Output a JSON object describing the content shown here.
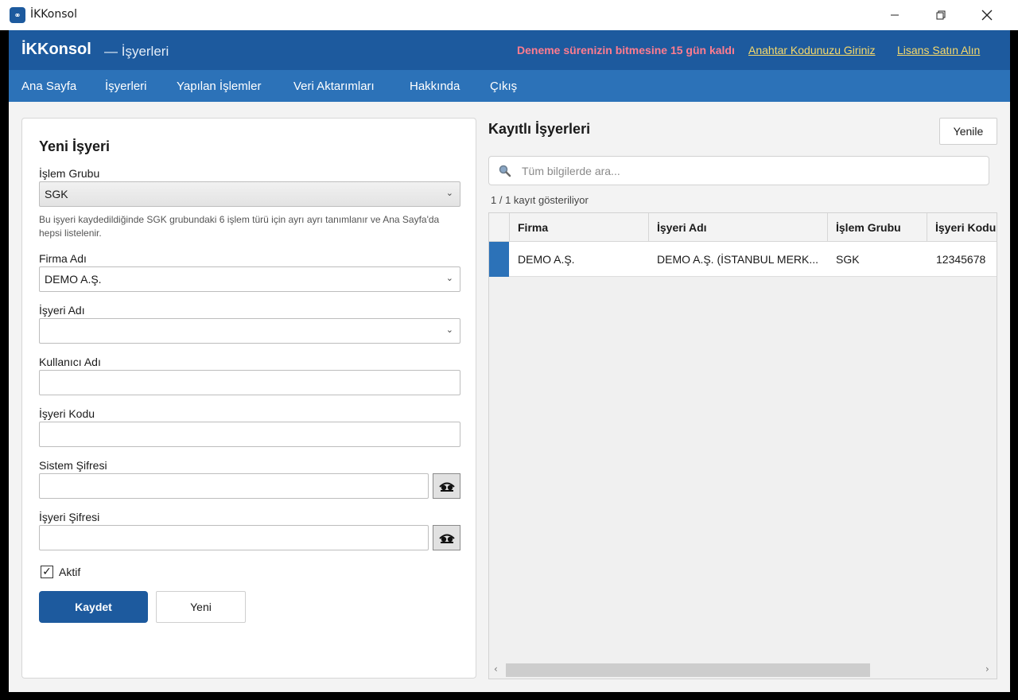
{
  "window": {
    "title": "İKKonsol",
    "app_icon_glyph": "⚭"
  },
  "header": {
    "brand": "İKKonsol",
    "subtitle": "— İşyerleri",
    "trial_text": "Deneme sürenizin bitmesine 15 gün kaldı",
    "key_link": "Anahtar Kodunuzu Giriniz",
    "buy_link": "Lisans Satın Alın",
    "colors": {
      "bar": "#1d5a9e",
      "trial": "#ff7c8f",
      "link": "#f6d96a"
    }
  },
  "nav": {
    "items": [
      {
        "label": "Ana Sayfa"
      },
      {
        "label": "İşyerleri"
      },
      {
        "label": "Yapılan İşlemler"
      },
      {
        "label": "Veri Aktarımları"
      },
      {
        "label": "Hakkında"
      },
      {
        "label": "Çıkış"
      }
    ]
  },
  "form": {
    "title": "Yeni İşyeri",
    "islem_grubu": {
      "label": "İşlem Grubu",
      "value": "SGK"
    },
    "help_text": "Bu işyeri kaydedildiğinde SGK grubundaki 6 işlem türü için ayrı ayrı tanımlanır ve Ana Sayfa'da hepsi listelenir.",
    "firma_adi": {
      "label": "Firma Adı",
      "value": "DEMO A.Ş."
    },
    "isyeri_adi": {
      "label": "İşyeri Adı",
      "value": ""
    },
    "kullanici_adi": {
      "label": "Kullanıcı Adı",
      "value": ""
    },
    "isyeri_kodu": {
      "label": "İşyeri Kodu",
      "value": ""
    },
    "sistem_sifresi": {
      "label": "Sistem Şifresi",
      "value": ""
    },
    "isyeri_sifresi": {
      "label": "İşyeri Şifresi",
      "value": ""
    },
    "aktif": {
      "label": "Aktif",
      "checked": true
    },
    "save_label": "Kaydet",
    "new_label": "Yeni"
  },
  "list": {
    "title": "Kayıtlı İşyerleri",
    "refresh_label": "Yenile",
    "search_placeholder": "Tüm bilgilerde ara...",
    "count_text": "1 / 1 kayıt gösteriliyor",
    "columns": [
      "Firma",
      "İşyeri Adı",
      "İşlem Grubu",
      "İşyeri Kodu"
    ],
    "rows": [
      {
        "firma": "DEMO A.Ş.",
        "isyeri_adi": "DEMO A.Ş. (İSTANBUL MERK...",
        "islem_grubu": "SGK",
        "isyeri_kodu": "12345678"
      }
    ]
  }
}
